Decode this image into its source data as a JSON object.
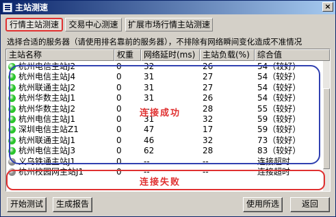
{
  "window": {
    "title": "主站测速",
    "close_glyph": "×"
  },
  "tabs": [
    {
      "label": "行情主站测速",
      "active": true
    },
    {
      "label": "交易中心测速",
      "active": false
    },
    {
      "label": "扩展市场行情主站测速",
      "active": false
    }
  ],
  "description": "选择合适的服务器（请使用排名靠前的服务器），不排除有网络瞬间变化造成不准情况",
  "table": {
    "headers": [
      "主站名称",
      "权重",
      "网络延时(ms)",
      "主站负载(%)",
      "综合值"
    ],
    "rows": [
      {
        "name": "杭州电信主站J2",
        "weight": "0",
        "latency": "32",
        "load": "26",
        "score": "54（较好）",
        "status": "ok"
      },
      {
        "name": "杭州电信主站J4",
        "weight": "0",
        "latency": "31",
        "load": "27",
        "score": "54（较好）",
        "status": "ok"
      },
      {
        "name": "杭州联通主站J2",
        "weight": "0",
        "latency": "31",
        "load": "27",
        "score": "54（较好）",
        "status": "ok"
      },
      {
        "name": "杭州华数主站J1",
        "weight": "0",
        "latency": "31",
        "load": "26",
        "score": "54（较好）",
        "status": "ok"
      },
      {
        "name": "杭州华数主站J2",
        "weight": "0",
        "latency": "--",
        "load": "28",
        "score": "55（较好）",
        "status": "ok"
      },
      {
        "name": "杭州电信主站J1",
        "weight": "0",
        "latency": "31",
        "load": "32",
        "score": "59（较好）",
        "status": "ok"
      },
      {
        "name": "深圳电信主站Z1",
        "weight": "0",
        "latency": "47",
        "load": "17",
        "score": "59（较好）",
        "status": "ok"
      },
      {
        "name": "杭州联通主站J1",
        "weight": "0",
        "latency": "46",
        "load": "32",
        "score": "73（较好）",
        "status": "ok"
      },
      {
        "name": "杭州电信主站J3",
        "weight": "0",
        "latency": "62",
        "load": "28",
        "score": "83（较好）",
        "status": "ok"
      },
      {
        "name": "义乌铁通主站J1",
        "weight": "0",
        "latency": "--",
        "load": "--",
        "score": "连接超时",
        "status": "fail"
      },
      {
        "name": "杭州校园网主站J1",
        "weight": "0",
        "latency": "--",
        "load": "--",
        "score": "连接超时",
        "status": "fail"
      }
    ]
  },
  "annotations": {
    "success": "连接成功",
    "fail": "连接失败"
  },
  "buttons": {
    "start_test": "开始测试",
    "generate_report": "生成报告",
    "use_selected": "使用所选",
    "back": "返回"
  },
  "colors": {
    "ok_dot": "#2ac42a",
    "fail_dot": "#8a8a8a",
    "annotation_blue": "#3040b0",
    "annotation_red": "#e03030"
  }
}
